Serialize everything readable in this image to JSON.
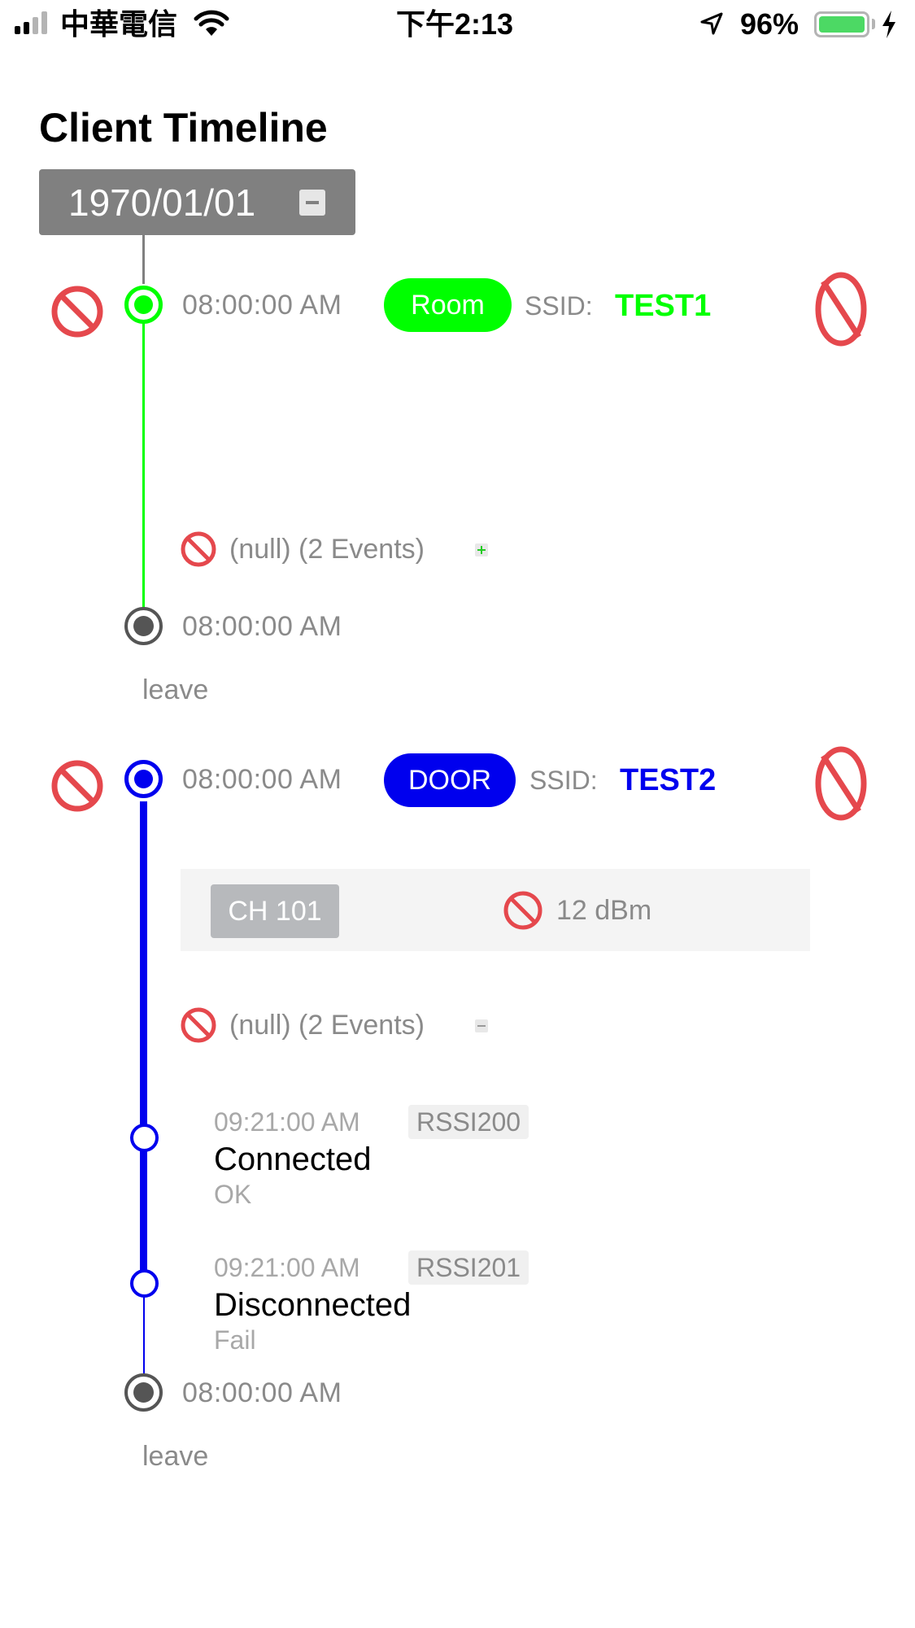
{
  "status_bar": {
    "carrier": "中華電信",
    "time": "下午2:13",
    "battery": "96%"
  },
  "page": {
    "title": "Client Timeline",
    "date": "1970/01/01"
  },
  "sessions": [
    {
      "time": "08:00:00 AM",
      "tag": "Room",
      "ssid_label": "SSID:",
      "ssid": "TEST1",
      "color": "#00ff00",
      "group_label": "(null) (2 Events)",
      "group_expanded": false,
      "end_time": "08:00:00 AM",
      "end_label": "leave"
    },
    {
      "time": "08:00:00 AM",
      "tag": "DOOR",
      "ssid_label": "SSID:",
      "ssid": "TEST2",
      "color": "#0000ee",
      "channel": "CH 101",
      "signal": "12 dBm",
      "group_label": "(null) (2 Events)",
      "group_expanded": true,
      "events": [
        {
          "time": "09:21:00 AM",
          "rssi": "RSSI200",
          "title": "Connected",
          "status": "OK"
        },
        {
          "time": "09:21:00 AM",
          "rssi": "RSSI201",
          "title": "Disconnected",
          "status": "Fail"
        }
      ],
      "end_time": "08:00:00 AM",
      "end_label": "leave"
    }
  ],
  "colors": {
    "no_icon": "#e5484d",
    "grey_text": "#8a8a8a",
    "date_bg": "#808080"
  }
}
